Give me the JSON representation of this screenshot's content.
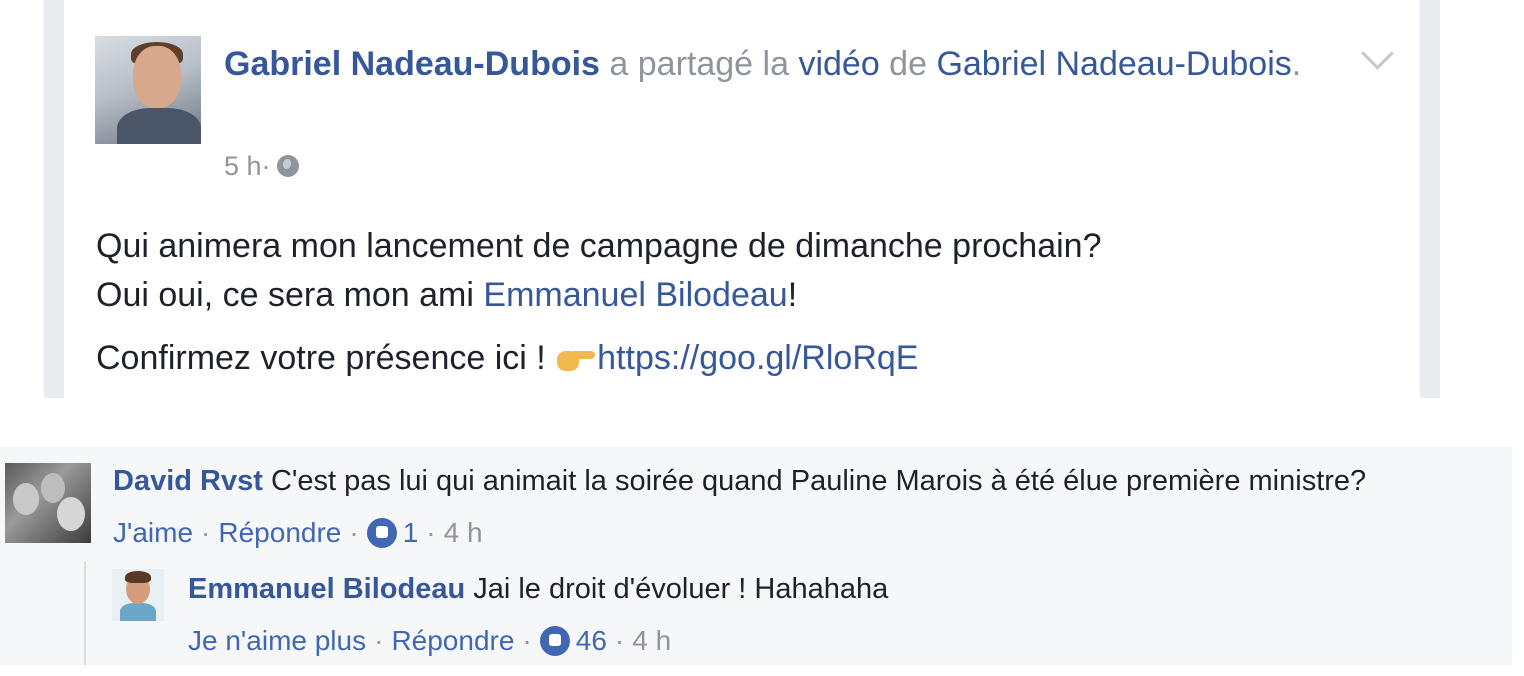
{
  "post": {
    "author": "Gabriel Nadeau-Dubois",
    "shared_text": " a partagé la ",
    "video_label": "vidéo",
    "of_text": " de ",
    "page_name": "Gabriel Nadeau-Dubois",
    "end_punct": ".",
    "time": "5 h",
    "meta_sep": " · ",
    "line1": "Qui animera mon lancement de campagne de dimanche prochain?",
    "line2_prefix": "Oui oui, ce sera mon ami ",
    "mention": "Emmanuel Bilodeau",
    "line2_suffix": "!",
    "line3_prefix": "Confirmez votre présence ici ! ",
    "url": "https://goo.gl/RloRqE",
    "icons": {
      "visibility": "globe-icon",
      "options": "chevron-down-icon",
      "emoji": "pointing-hand-icon"
    }
  },
  "comments": [
    {
      "author": "David Rvst",
      "text": " C'est pas lui qui animait la soirée quand Pauline Marois à été élue première ministre?",
      "like_label": "J'aime",
      "reply_label": "Répondre",
      "likes": "1",
      "time": "4 h",
      "sep": "·"
    },
    {
      "author": "Emmanuel Bilodeau",
      "text": " Jai le droit d'évoluer ! Hahahaha",
      "like_label": "Je n'aime plus",
      "reply_label": "Répondre",
      "likes": "46",
      "time": "4 h",
      "sep": "·"
    }
  ],
  "colors": {
    "link": "#365899",
    "meta": "#90949c",
    "text": "#1d2129",
    "comments_bg": "#f6f7f9",
    "like_badge": "#4267b2"
  }
}
